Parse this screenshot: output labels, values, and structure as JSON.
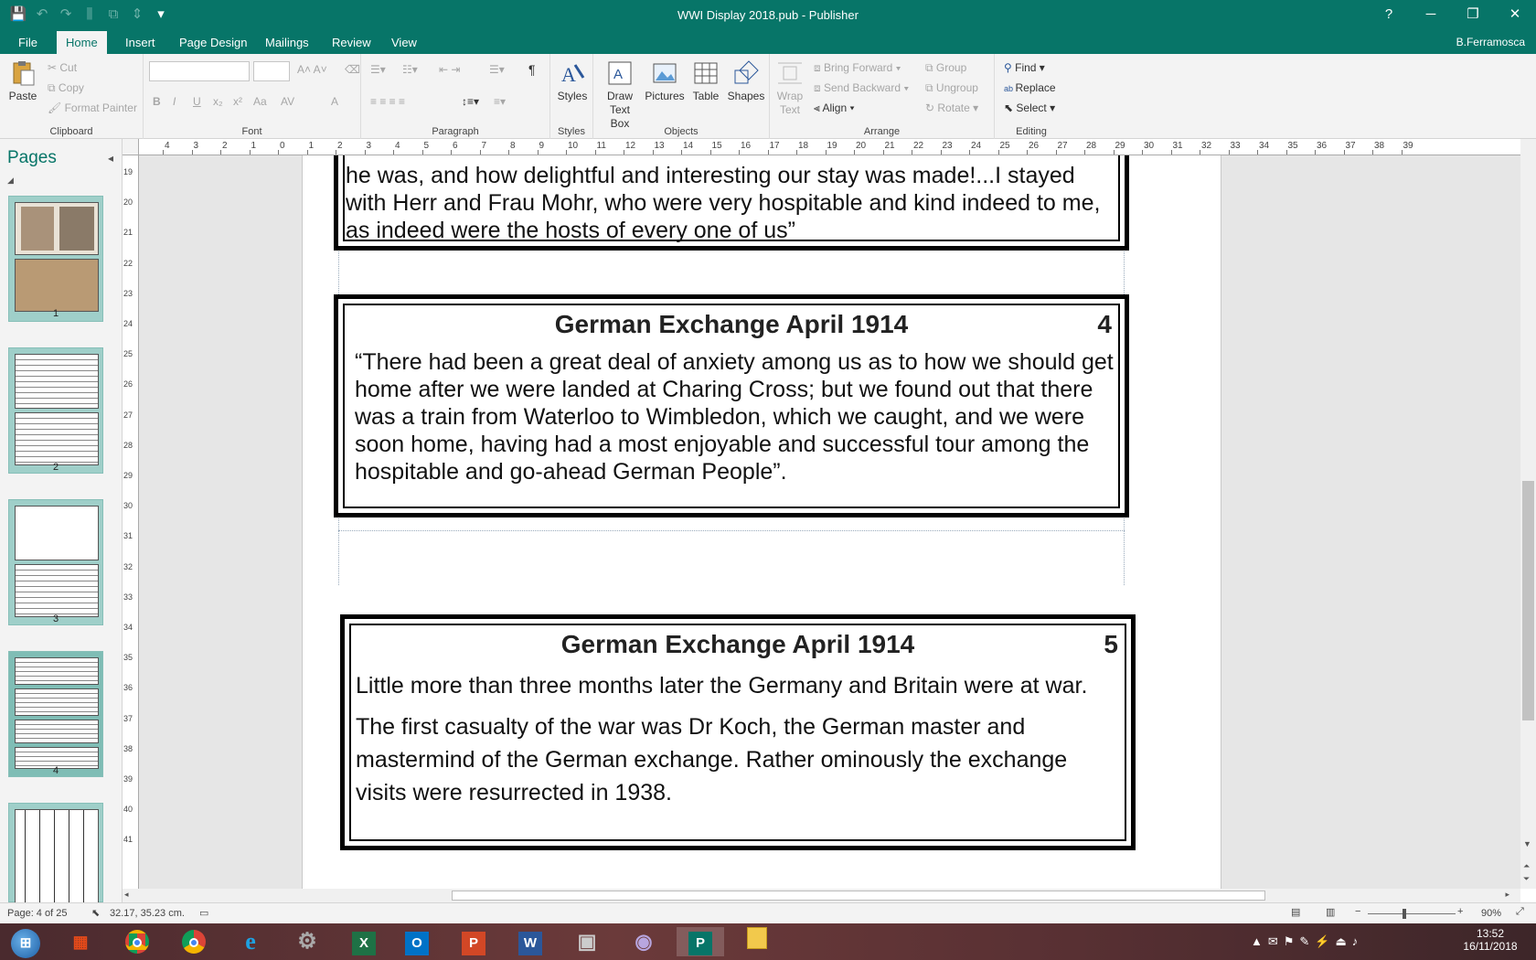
{
  "window": {
    "title": "WWI Display 2018.pub - Publisher",
    "controls": [
      "?",
      "─",
      "❐",
      "✕"
    ],
    "user": "B.Ferramosca"
  },
  "quick_access": [
    "save-icon",
    "undo-icon",
    "redo-icon",
    "align-icon",
    "group-icon",
    "distribute-icon",
    "customize-icon"
  ],
  "tabs": [
    "File",
    "Home",
    "Insert",
    "Page Design",
    "Mailings",
    "Review",
    "View"
  ],
  "active_tab": "Home",
  "ribbon": {
    "clipboard": {
      "label": "Clipboard",
      "paste": "Paste",
      "cut": "Cut",
      "copy": "Copy",
      "format_painter": "Format Painter"
    },
    "font": {
      "label": "Font",
      "bold": "B",
      "italic": "I",
      "underline": "U",
      "subscript": "x₂",
      "superscript": "x²",
      "change_case": "Aa",
      "spacing": "AV",
      "font_color": "A"
    },
    "paragraph": {
      "label": "Paragraph",
      "show_marks": "¶"
    },
    "styles": {
      "label": "Styles",
      "button": "Styles"
    },
    "objects": {
      "label": "Objects",
      "draw_text_box_1": "Draw",
      "draw_text_box_2": "Text Box",
      "pictures": "Pictures",
      "table": "Table",
      "shapes": "Shapes"
    },
    "arrange": {
      "label": "Arrange",
      "wrap_text_1": "Wrap",
      "wrap_text_2": "Text",
      "bring_forward": "Bring Forward",
      "send_backward": "Send Backward",
      "align": "Align",
      "group": "Group",
      "ungroup": "Ungroup",
      "rotate": "Rotate"
    },
    "editing": {
      "label": "Editing",
      "find": "Find",
      "replace": "Replace",
      "select": "Select"
    }
  },
  "pages_pane": {
    "heading": "Pages",
    "thumbnails": [
      {
        "number": "1",
        "selected": false
      },
      {
        "number": "2",
        "selected": false
      },
      {
        "number": "3",
        "selected": false
      },
      {
        "number": "4",
        "selected": true
      },
      {
        "number": "",
        "selected": false
      }
    ]
  },
  "rulers": {
    "horizontal": [
      "4",
      "3",
      "2",
      "1",
      "0",
      "1",
      "2",
      "3",
      "4",
      "5",
      "6",
      "7",
      "8",
      "9",
      "10",
      "11",
      "12",
      "13",
      "14",
      "15",
      "16",
      "17",
      "18",
      "19",
      "20",
      "21",
      "22",
      "23",
      "24",
      "25",
      "26",
      "27",
      "28",
      "29",
      "30",
      "31",
      "32",
      "33",
      "34",
      "35",
      "36",
      "37",
      "38",
      "39"
    ],
    "vertical": [
      "19",
      "20",
      "21",
      "22",
      "23",
      "24",
      "25",
      "26",
      "27",
      "28",
      "29",
      "30",
      "31",
      "32",
      "33",
      "34",
      "35",
      "36",
      "37",
      "38",
      "39",
      "40",
      "41"
    ]
  },
  "document": {
    "frame_top": {
      "lines": [
        "he was, and how delightful and interesting our stay was made!...I stayed",
        "with Herr and Frau Mohr, who were very hospitable and kind indeed to me,",
        "as indeed were the hosts of every one of us”"
      ]
    },
    "frame_4": {
      "title": "German Exchange April 1914",
      "number": "4",
      "lines": [
        "“There had been a great deal of anxiety among us as to how we should get",
        "home after we were landed at Charing Cross; but we found out that there",
        "was a train from Waterloo to Wimbledon, which we caught, and we were",
        "soon home, having had a most enjoyable and successful tour among the",
        "hospitable and go-ahead German People”."
      ]
    },
    "frame_5": {
      "title": "German Exchange April 1914",
      "number": "5",
      "para1": "Little more than three months later the Germany and Britain were at war.",
      "para2_lines": [
        "The first casualty of the war was Dr Koch, the German master and",
        "mastermind of the German exchange. Rather ominously the exchange",
        "visits were resurrected in 1938."
      ]
    }
  },
  "status": {
    "page": "Page: 4 of 25",
    "position": "32.17, 35.23 cm.",
    "zoom": "90%"
  },
  "taskbar": {
    "apps": [
      "start-orb",
      "app-grid",
      "chrome",
      "chrome",
      "internet-explorer",
      "settings",
      "excel",
      "outlook",
      "powerpoint",
      "word",
      "camera",
      "media",
      "publisher",
      "file-explorer"
    ],
    "time": "13:52",
    "date": "16/11/2018"
  },
  "colors": {
    "accent": "#077568",
    "ribbon": "#f3f3f3",
    "canvas": "#e6e6e6"
  }
}
